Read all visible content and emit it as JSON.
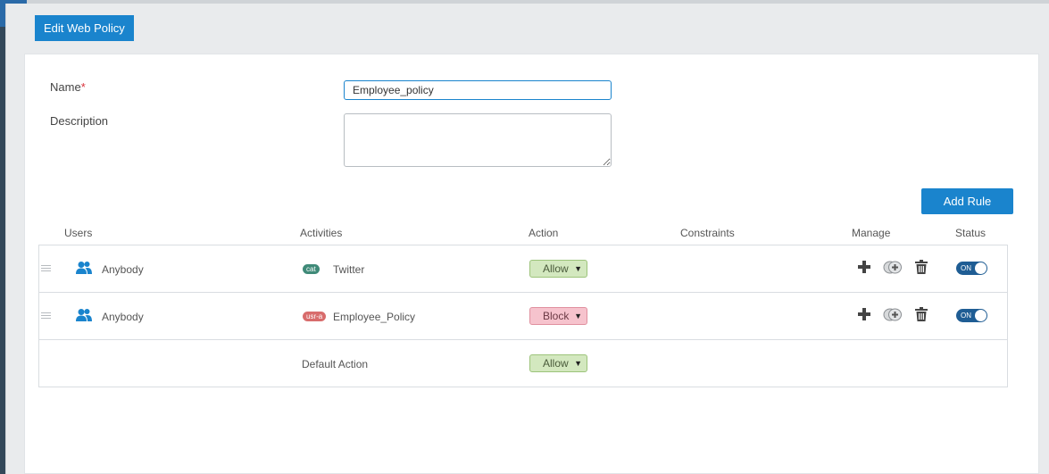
{
  "dialog": {
    "title": "Edit Web Policy"
  },
  "form": {
    "name_label": "Name",
    "name_required_mark": "*",
    "name_value": "Employee_policy",
    "description_label": "Description",
    "description_value": ""
  },
  "toolbar": {
    "add_rule_label": "Add Rule"
  },
  "table": {
    "headers": {
      "users": "Users",
      "activities": "Activities",
      "action": "Action",
      "constraints": "Constraints",
      "manage": "Manage",
      "status": "Status"
    },
    "rows": [
      {
        "user": "Anybody",
        "activity_tag": "cat",
        "activity": "Twitter",
        "action": "Allow",
        "status": "ON"
      },
      {
        "user": "Anybody",
        "activity_tag": "usr-a",
        "activity": "Employee_Policy",
        "action": "Block",
        "status": "ON"
      }
    ],
    "default_row": {
      "label": "Default Action",
      "action": "Allow"
    }
  },
  "icons": {
    "drag": "drag-handle-icon",
    "user": "users-group-icon",
    "add": "plus-icon",
    "clone": "clone-add-icon",
    "delete": "trash-icon",
    "dropdown": "caret-down-icon"
  },
  "colors": {
    "accent": "#1a84cd",
    "allow_bg": "#d3e8bf",
    "block_bg": "#f6c3cd",
    "toggle_on": "#1f5d94",
    "category_tag": "#3f8a78",
    "user_activity_tag": "#d86c6c"
  }
}
